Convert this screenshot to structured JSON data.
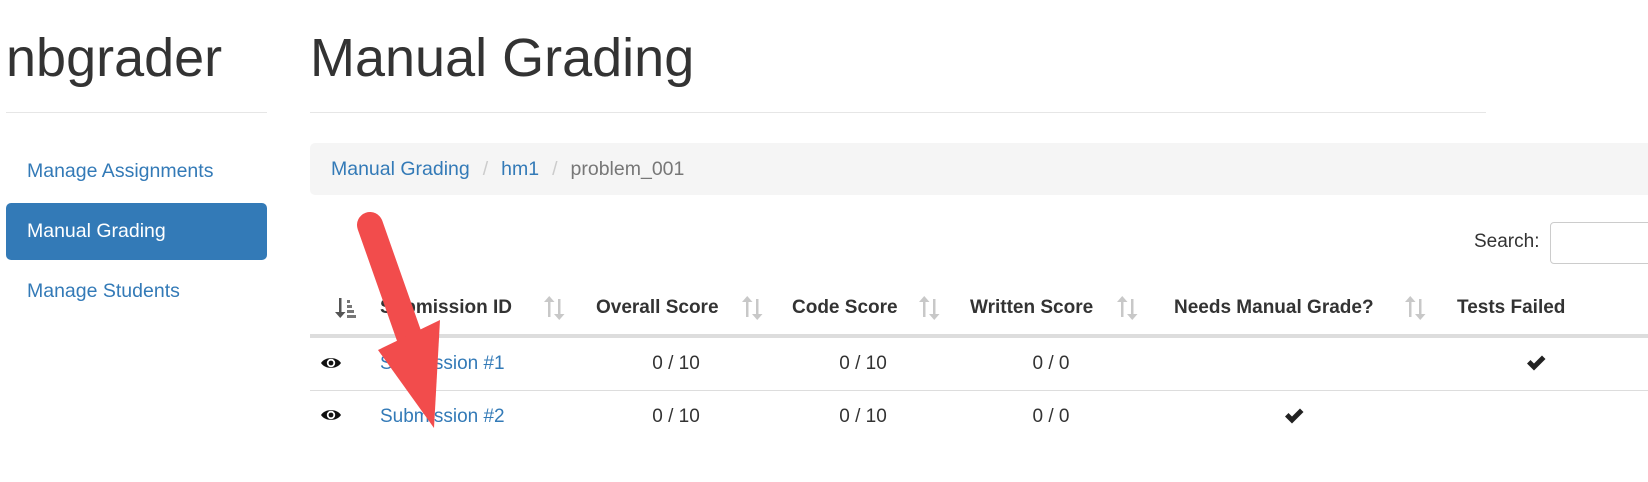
{
  "sidebar": {
    "app_title": "nbgrader",
    "nav": [
      {
        "label": "Manage Assignments",
        "active": false
      },
      {
        "label": "Manual Grading",
        "active": true
      },
      {
        "label": "Manage Students",
        "active": false
      }
    ]
  },
  "main": {
    "title": "Manual Grading",
    "breadcrumb": [
      {
        "label": "Manual Grading",
        "link": true
      },
      {
        "label": "hm1",
        "link": true
      },
      {
        "label": "problem_001",
        "link": false
      }
    ],
    "search": {
      "label": "Search:",
      "value": ""
    },
    "table": {
      "columns": [
        "Submission ID",
        "Overall Score",
        "Code Score",
        "Written Score",
        "Needs Manual Grade?",
        "Tests Failed"
      ],
      "rows": [
        {
          "id": "Submission #1",
          "overall": "0 / 10",
          "code": "0 / 10",
          "written": "0 / 0",
          "needs_manual_grade": false,
          "tests_failed": true
        },
        {
          "id": "Submission #2",
          "overall": "0 / 10",
          "code": "0 / 10",
          "written": "0 / 0",
          "needs_manual_grade": true,
          "tests_failed": false
        }
      ]
    }
  },
  "icons": {
    "view": "eye-icon",
    "check": "checkmark-icon",
    "sort": "sort-both-icon",
    "sort_active": "sort-ascending-icon"
  },
  "colors": {
    "link": "#337ab7",
    "active_nav_bg": "#337ab7",
    "breadcrumb_bg": "#f5f5f5",
    "annotation_arrow": "#f24c4c"
  }
}
